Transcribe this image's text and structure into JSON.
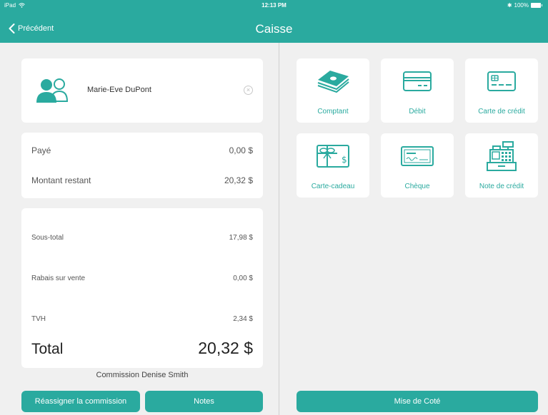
{
  "status_bar": {
    "device": "iPad",
    "wifi_icon": "wifi-icon",
    "time": "12:13 PM",
    "bluetooth": "✱",
    "battery": "100%"
  },
  "nav": {
    "back_label": "Précédent",
    "title": "Caisse"
  },
  "customer": {
    "name": "Marie-Eve DuPont",
    "avatar_icon": "customers-icon",
    "clear_glyph": "×"
  },
  "payment_status": {
    "paid_label": "Payé",
    "paid_value": "0,00 $",
    "remaining_label": "Montant restant",
    "remaining_value": "20,32 $"
  },
  "totals": {
    "subtotal_label": "Sous-total",
    "subtotal_value": "17,98 $",
    "discount_label": "Rabais sur vente",
    "discount_value": "0,00 $",
    "tax_label": "TVH",
    "tax_value": "2,34 $",
    "total_label": "Total",
    "total_value": "20,32 $"
  },
  "commission_text": "Commission Denise Smith",
  "buttons": {
    "reassign": "Réassigner la commission",
    "notes": "Notes",
    "set_aside": "Mise de Coté"
  },
  "payment_methods": [
    {
      "label": "Comptant",
      "icon": "cash-icon"
    },
    {
      "label": "Débit",
      "icon": "debit-card-icon"
    },
    {
      "label": "Carte de crédit",
      "icon": "credit-card-icon"
    },
    {
      "label": "Carte-cadeau",
      "icon": "gift-card-icon"
    },
    {
      "label": "Chèque",
      "icon": "cheque-icon"
    },
    {
      "label": "Note de crédit",
      "icon": "cash-register-icon"
    }
  ],
  "colors": {
    "accent": "#2aaa9f",
    "background": "#f0f0f0",
    "card": "#ffffff"
  }
}
